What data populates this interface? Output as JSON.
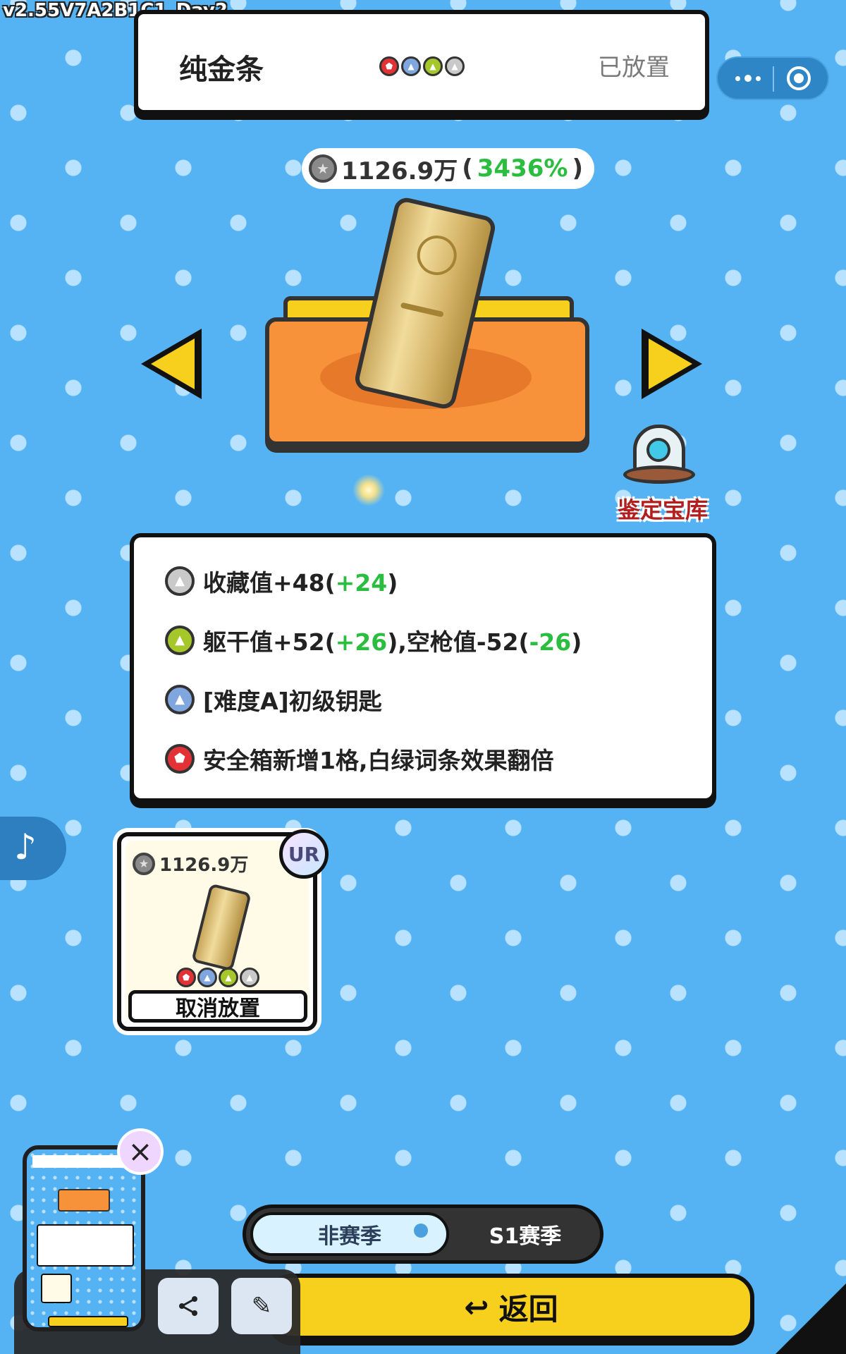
{
  "version_label": "v2.55V7A2B1C1_Day2",
  "header": {
    "item_name": "纯金条",
    "status": "已放置",
    "badges": [
      "red-pentagon-icon",
      "blue-triangle-icon",
      "green-triangle-icon",
      "gray-triangle-icon"
    ]
  },
  "value": {
    "amount": "1126.9万",
    "open_paren": "(",
    "percent": "3436%",
    "close_paren": ")"
  },
  "vault": {
    "label": "鉴定宝库"
  },
  "effects": [
    {
      "icon": "gray-triangle-icon",
      "text1": "收藏值+48(",
      "hl1": "+24",
      "text2": ")",
      "hl2": "",
      "text3": ""
    },
    {
      "icon": "green-triangle-icon",
      "text1": "躯干值+52(",
      "hl1": "+26",
      "text2": "),空枪值-52(",
      "hl2": "-26",
      "text3": ")"
    },
    {
      "icon": "blue-triangle-icon",
      "text1": "[难度A]初级钥匙",
      "hl1": "",
      "text2": "",
      "hl2": "",
      "text3": ""
    },
    {
      "icon": "red-pentagon-icon",
      "text1": "安全箱新增1格,白绿词条效果翻倍",
      "hl1": "",
      "text2": "",
      "hl2": "",
      "text3": ""
    }
  ],
  "item_card": {
    "value": "1126.9万",
    "rarity": "UR",
    "action_label": "取消放置"
  },
  "season_toggle": {
    "options": [
      "非赛季",
      "S1赛季"
    ],
    "selected": "非赛季"
  },
  "return_button": {
    "label": "返回"
  },
  "colors": {
    "background": "#55b3f3",
    "accent_yellow": "#f7cf1d",
    "highlight_green": "#2bbd3f",
    "vault_red": "#b21e1e"
  }
}
